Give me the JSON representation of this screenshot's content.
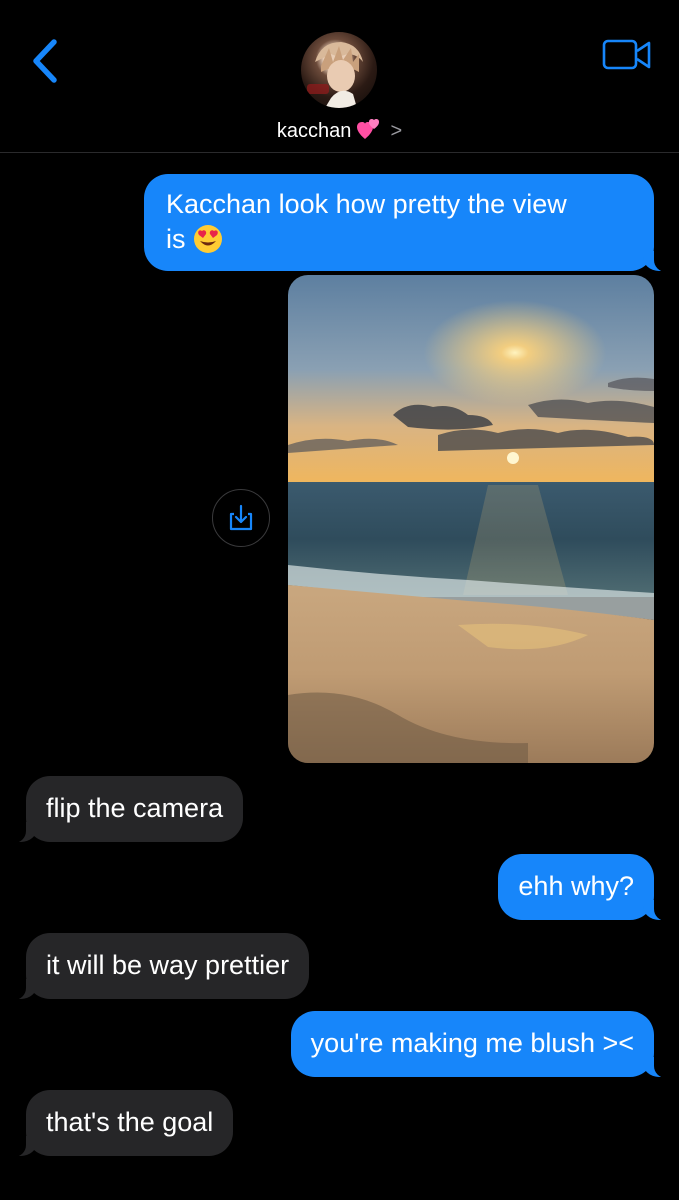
{
  "header": {
    "contact_name": "kacchan",
    "contact_emoji": "two-hearts-emoji",
    "chevron": ">",
    "back_icon": "chevron-left-icon",
    "video_icon": "video-camera-icon",
    "accent_color": "#1786fa"
  },
  "messages": [
    {
      "from": "me",
      "text": "Kacchan look how pretty the view",
      "text_line2": "is",
      "emoji": "heart-eyes-emoji"
    },
    {
      "from": "me",
      "type": "photo",
      "subject": "sunset over the ocean and beach",
      "action_icon": "save-download-icon"
    },
    {
      "from": "them",
      "text": "flip the camera"
    },
    {
      "from": "me",
      "text": "ehh why?"
    },
    {
      "from": "them",
      "text": "it will be way prettier"
    },
    {
      "from": "me",
      "text": "you're making me blush ><"
    },
    {
      "from": "them",
      "text": "that's the goal"
    }
  ],
  "colors": {
    "outgoing_bubble": "#1786fa",
    "incoming_bubble": "#262628",
    "background": "#000000"
  }
}
